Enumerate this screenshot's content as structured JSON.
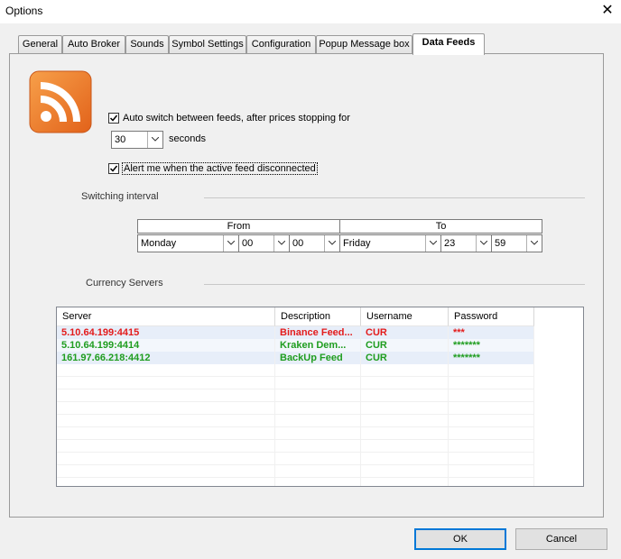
{
  "window": {
    "title": "Options",
    "close_glyph": "✕"
  },
  "tabs": [
    {
      "label": "General"
    },
    {
      "label": "Auto Broker"
    },
    {
      "label": "Sounds"
    },
    {
      "label": "Symbol Settings"
    },
    {
      "label": "Configuration"
    },
    {
      "label": "Popup Message box"
    },
    {
      "label": "Data Feeds"
    }
  ],
  "active_tab": "Data Feeds",
  "feeds": {
    "icon": "rss-feed-icon",
    "auto_switch": {
      "checked": true,
      "label": "Auto switch between feeds, after prices stopping for"
    },
    "stop_seconds": {
      "value": "30",
      "unit_label": "seconds"
    },
    "alert": {
      "checked": true,
      "label": "Alert me when the active feed disconnected"
    }
  },
  "switching": {
    "title": "Switching interval",
    "from_label": "From",
    "to_label": "To",
    "from": {
      "day": "Monday",
      "hour": "00",
      "minute": "00"
    },
    "to": {
      "day": "Friday",
      "hour": "23",
      "minute": "59"
    }
  },
  "servers": {
    "title": "Currency Servers",
    "columns": [
      "Server",
      "Description",
      "Username",
      "Password"
    ],
    "rows": [
      {
        "server": "5.10.64.199:4415",
        "description": "Binance Feed...",
        "username": "CUR",
        "password": "***",
        "status_color": "#e31b1b",
        "row_bg": "#e7eef9"
      },
      {
        "server": "5.10.64.199:4414",
        "description": "Kraken Dem...",
        "username": "CUR",
        "password": "*******",
        "status_color": "#1f9d1f",
        "row_bg": "#f3f7fc"
      },
      {
        "server": "161.97.66.218:4412",
        "description": "BackUp Feed",
        "username": "CUR",
        "password": "*******",
        "status_color": "#1f9d1f",
        "row_bg": "#e7eef9"
      }
    ]
  },
  "buttons": {
    "ok": "OK",
    "cancel": "Cancel"
  },
  "colors": {
    "rss_orange": "#f07a1c",
    "accent": "#0078d7"
  }
}
